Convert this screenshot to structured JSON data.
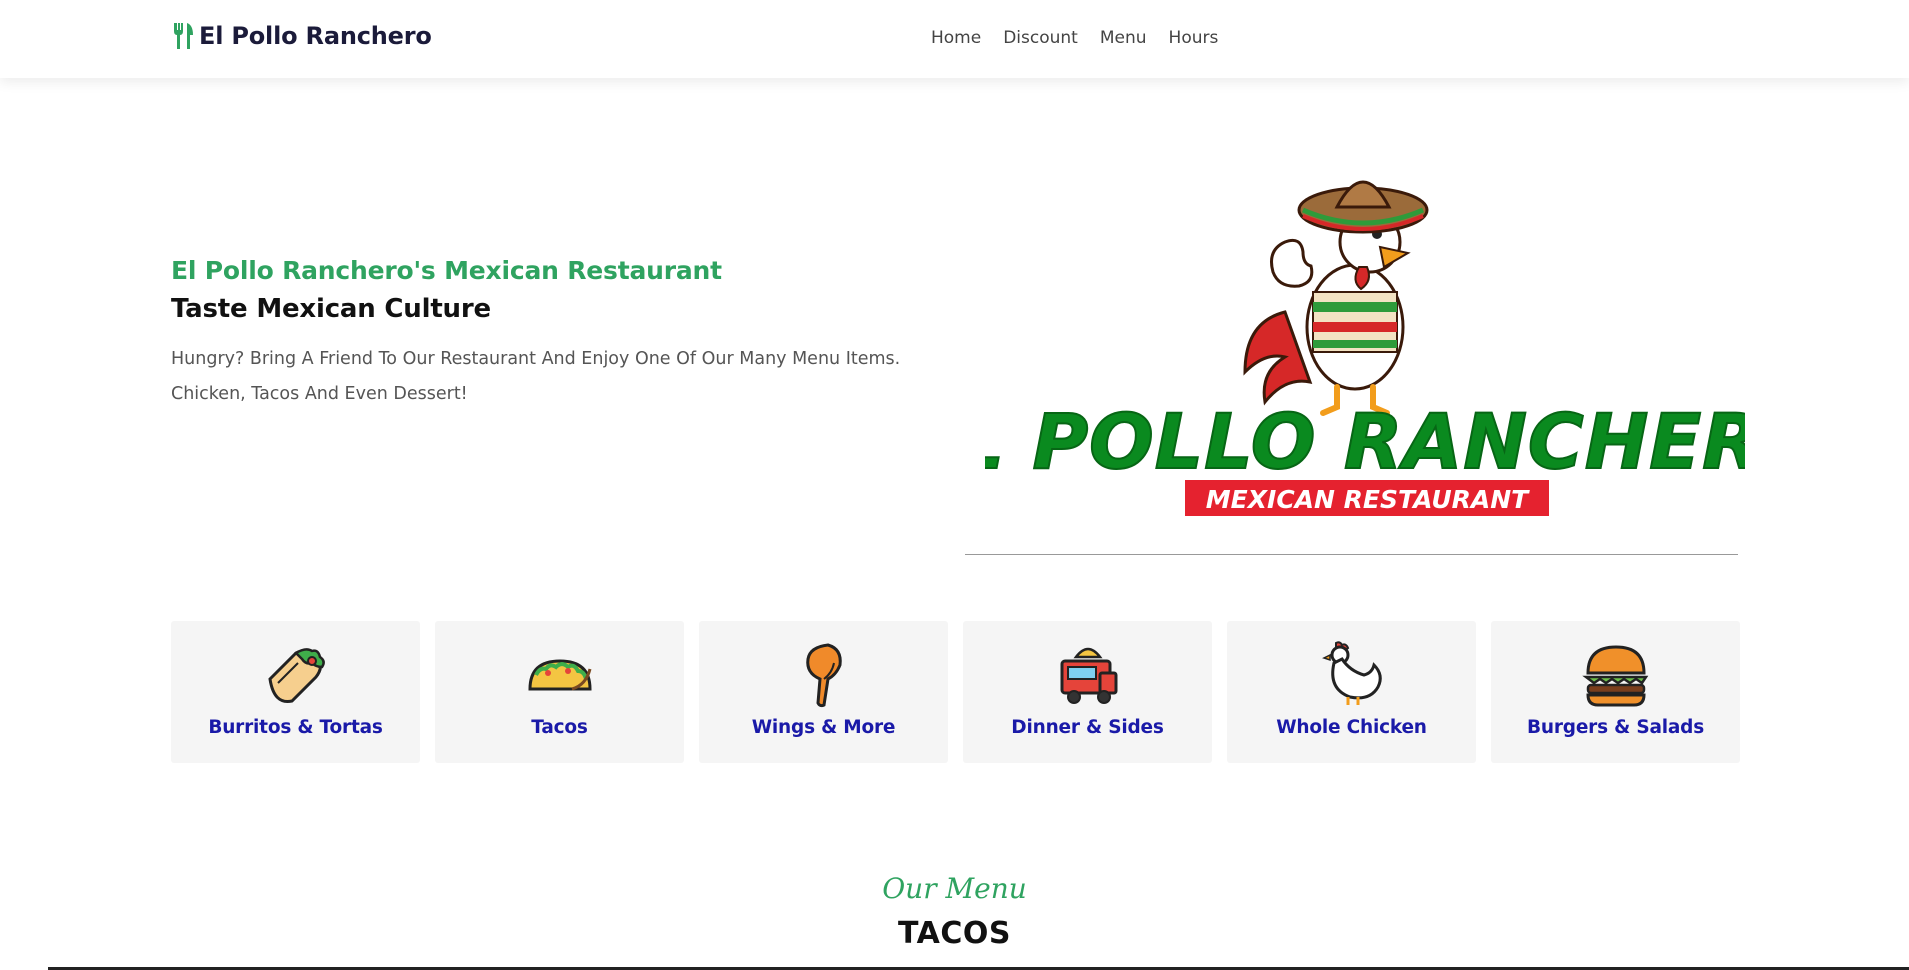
{
  "header": {
    "brand": "El Pollo Ranchero",
    "brand_icon": "utensils-icon",
    "nav": [
      "Home",
      "Discount",
      "Menu",
      "Hours"
    ]
  },
  "hero": {
    "subtitle": "El Pollo Ranchero's Mexican Restaurant",
    "title": "Taste Mexican Culture",
    "text": "Hungry? Bring A Friend To Our Restaurant And Enjoy One Of Our Many Menu Items. Chicken, Tacos And Even Dessert!",
    "logo": {
      "name": "EL POLLO RANCHERO",
      "tagline": "MEXICAN RESTAURANT"
    }
  },
  "categories": [
    {
      "label": "Burritos & Tortas",
      "icon": "burrito-icon"
    },
    {
      "label": "Tacos",
      "icon": "taco-icon"
    },
    {
      "label": "Wings & More",
      "icon": "wings-icon"
    },
    {
      "label": "Dinner & Sides",
      "icon": "food-truck-icon"
    },
    {
      "label": "Whole Chicken",
      "icon": "chicken-icon"
    },
    {
      "label": "Burgers & Salads",
      "icon": "burger-icon"
    }
  ],
  "menu": {
    "eyebrow": "Our Menu",
    "title": "TACOS"
  },
  "colors": {
    "accent_green": "#2fa360",
    "category_blue": "#1a1aa8",
    "logo_green": "#0a8a1f",
    "logo_red": "#e5222f"
  }
}
